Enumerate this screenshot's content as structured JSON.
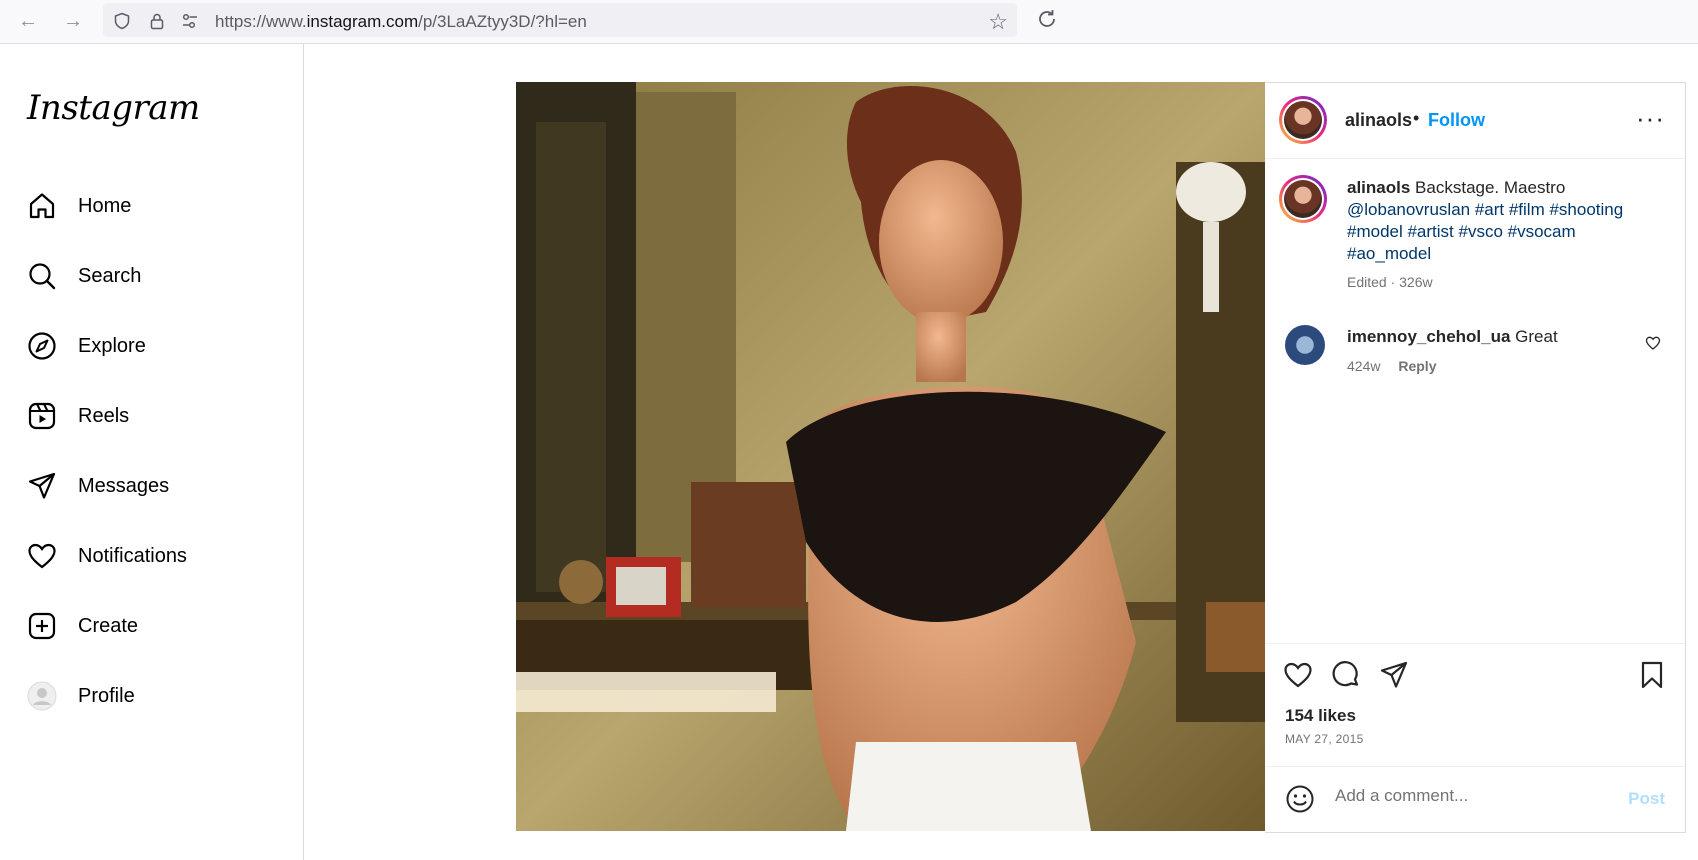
{
  "browser": {
    "url_prefix": "https://www.",
    "url_domain": "instagram.com",
    "url_path": "/p/3LaAZtyy3D/?hl=en"
  },
  "sidebar": {
    "logo": "Instagram",
    "items": [
      {
        "label": "Home",
        "icon": "home-icon"
      },
      {
        "label": "Search",
        "icon": "search-icon"
      },
      {
        "label": "Explore",
        "icon": "compass-icon"
      },
      {
        "label": "Reels",
        "icon": "reels-icon"
      },
      {
        "label": "Messages",
        "icon": "send-icon"
      },
      {
        "label": "Notifications",
        "icon": "heart-icon"
      },
      {
        "label": "Create",
        "icon": "plus-square-icon"
      },
      {
        "label": "Profile",
        "icon": "avatar"
      }
    ]
  },
  "post": {
    "author": "alinaols",
    "separator": "•",
    "follow_label": "Follow",
    "more_label": "···",
    "caption": {
      "user": "alinaols",
      "text": "Backstage. Maestro",
      "tags": "@lobanovruslan #art #film #shooting #model #artist #vsco #vsocam #ao_model",
      "meta": "Edited · 326w"
    },
    "comments": [
      {
        "user": "imennoy_chehol_ua",
        "text": "Great",
        "age": "424w",
        "reply_label": "Reply"
      }
    ],
    "likes": "154 likes",
    "date": "MAY 27, 2015",
    "add_comment_placeholder": "Add a comment...",
    "post_label": "Post"
  }
}
